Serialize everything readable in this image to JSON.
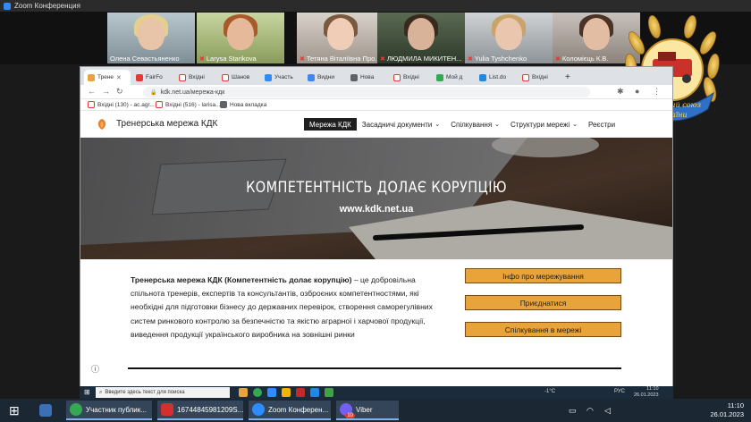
{
  "zoom": {
    "title": "Zoom Конференция"
  },
  "participants": [
    {
      "name": "Олена Севастьяненко",
      "muted": false
    },
    {
      "name": "Larysa Starikova",
      "muted": true
    },
    {
      "name": "Тетяна Віталіївна Про...",
      "muted": true
    },
    {
      "name": "ЛЮДМИЛА МИКИТЕН...",
      "muted": true
    },
    {
      "name": "Yulia Tyshchenko",
      "muted": true
    },
    {
      "name": "Коломієць К.В.",
      "muted": true
    }
  ],
  "badge": {
    "line1": "Аграрний союз",
    "line2": "України"
  },
  "browser": {
    "tabs": [
      "Трене",
      "FairFo",
      "Вхідні",
      "Шанов",
      "Участь",
      "Видни",
      "Нова",
      "Вхідні",
      "Мой д",
      "List.do",
      "Вхідні"
    ],
    "url": "kdk.net.ua/мережа-кдк",
    "bookmarks": [
      "Вхідні (130) - ac.agr...",
      "Вхідні (516) - larisa...",
      "Нова вкладка"
    ]
  },
  "site": {
    "title": "Тренерська мережа КДК",
    "menu": [
      {
        "label": "Мережа КДК",
        "dropdown": false
      },
      {
        "label": "Засадничі документи",
        "dropdown": true
      },
      {
        "label": "Спілкування",
        "dropdown": true
      },
      {
        "label": "Структури мережі",
        "dropdown": true
      },
      {
        "label": "Реєстри",
        "dropdown": false
      }
    ],
    "hero_title": "КОМПЕТЕНТНІСТЬ ДОЛАЄ КОРУПЦІЮ",
    "hero_url": "www.kdk.net.ua",
    "para_bold": "Тренерська мережа КДК (Компетентність долає корупцію)",
    "para_rest": " – це добровільна спільнота тренерів, експертів та консультантів, озброєних компетентностями, які необхідні для підготовки бізнесу до державних перевірок, створення саморегулівних систем ринкового контролю за безпечністю та якістю аграрної і харчової продукції, виведення продукції українського виробника на зовнішні ринки",
    "buttons": [
      "Інфо про мережування",
      "Приєднатися",
      "Спілкування в мережі"
    ]
  },
  "inner_taskbar": {
    "search": "Введите здесь текст для поиска",
    "weather": "-1°C",
    "lang": "РУС",
    "time": "11:10",
    "date": "26.01.2023"
  },
  "taskbar": {
    "items": [
      "Участник публик...",
      "16744845981209S...",
      "Zoom Конферен...",
      "Viber"
    ],
    "viber_badge": "10",
    "time": "11:10",
    "date": "26.01.2023"
  },
  "colors": {
    "accent_button": "#e8a33a",
    "menu_active": "#1f1f1f"
  }
}
